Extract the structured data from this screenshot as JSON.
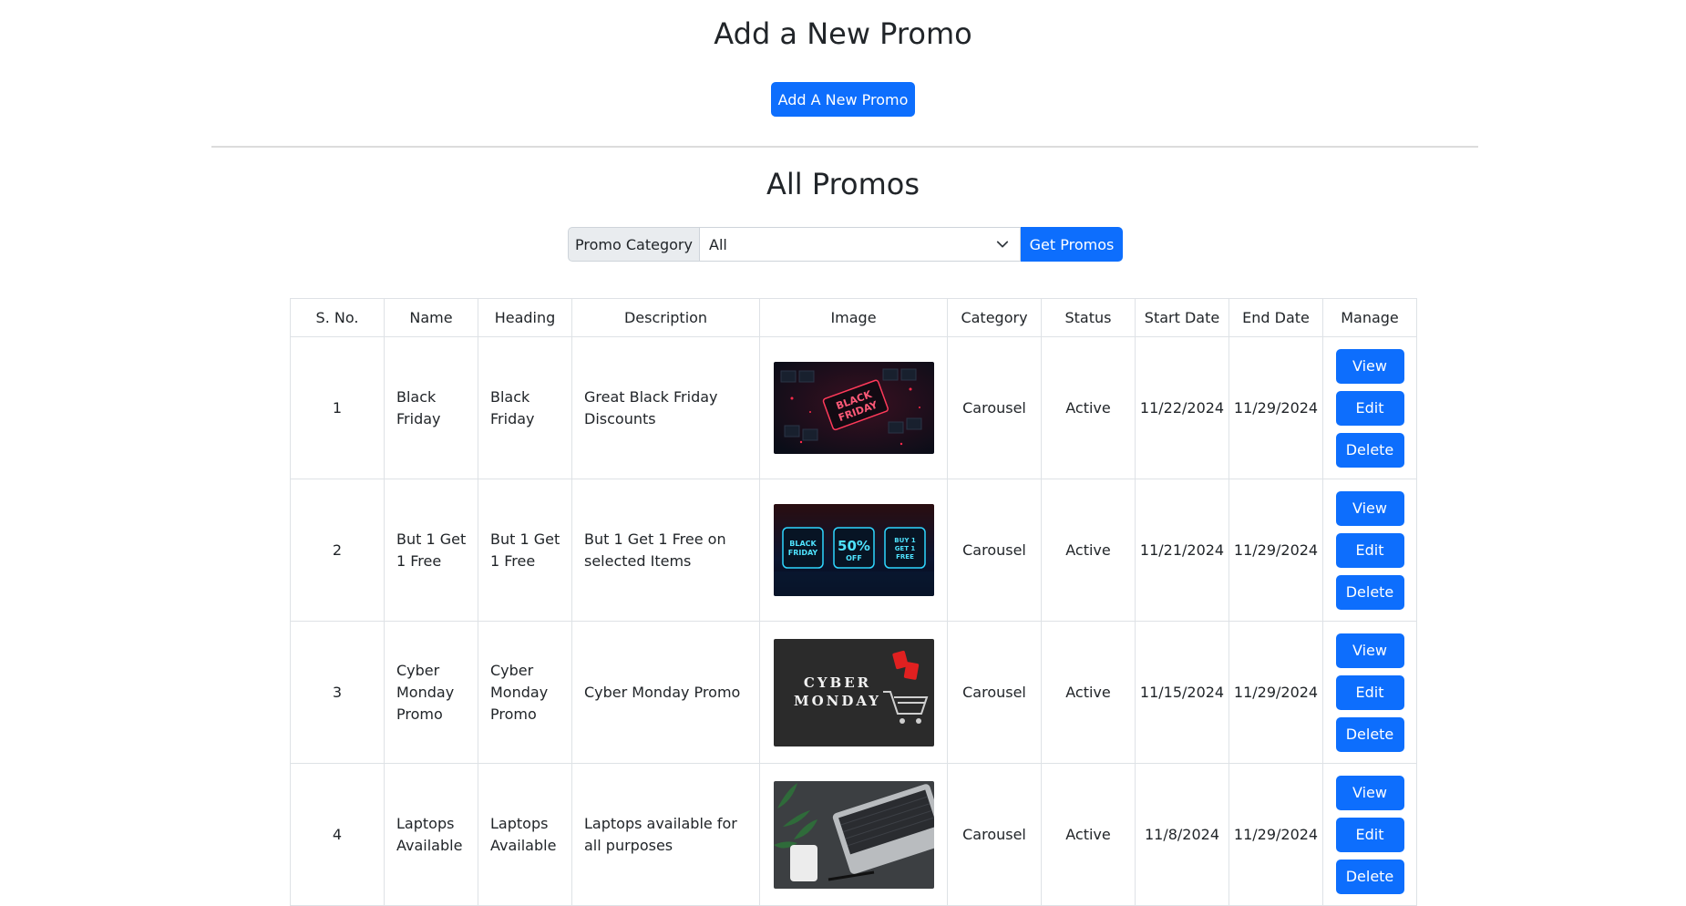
{
  "header": {
    "add_title": "Add a New Promo",
    "add_button": "Add A New Promo",
    "all_title": "All Promos"
  },
  "filter": {
    "label": "Promo Category",
    "selected": "All",
    "button": "Get Promos"
  },
  "table": {
    "columns": [
      "S. No.",
      "Name",
      "Heading",
      "Description",
      "Image",
      "Category",
      "Status",
      "Start Date",
      "End Date",
      "Manage"
    ],
    "actions": {
      "view": "View",
      "edit": "Edit",
      "delete": "Delete"
    },
    "rows": [
      {
        "sno": "1",
        "name": "Black Friday",
        "heading": "Black Friday",
        "description": "Great Black Friday Discounts",
        "image": {
          "alt": "black-friday-keyboard",
          "text": "BLACK FRIDAY"
        },
        "category": "Carousel",
        "status": "Active",
        "start": "11/22/2024",
        "end": "11/29/2024"
      },
      {
        "sno": "2",
        "name": "But 1 Get 1 Free",
        "heading": "But 1 Get 1 Free",
        "description": "But 1 Get 1 Free on selected Items",
        "image": {
          "alt": "neon-promo-boxes",
          "text": [
            "BLACK FRIDAY",
            "50% OFF",
            "BUY 1 GET 1 FREE"
          ]
        },
        "category": "Carousel",
        "status": "Active",
        "start": "11/21/2024",
        "end": "11/29/2024"
      },
      {
        "sno": "3",
        "name": "Cyber Monday Promo",
        "heading": "Cyber Monday Promo",
        "description": "Cyber Monday Promo",
        "image": {
          "alt": "cyber-monday-cart",
          "text": [
            "CYBER",
            "MONDAY"
          ]
        },
        "category": "Carousel",
        "status": "Active",
        "start": "11/15/2024",
        "end": "11/29/2024"
      },
      {
        "sno": "4",
        "name": "Laptops Available",
        "heading": "Laptops Available",
        "description": "Laptops available for all purposes",
        "image": {
          "alt": "laptop-desk"
        },
        "category": "Carousel",
        "status": "Active",
        "start": "11/8/2024",
        "end": "11/29/2024"
      }
    ]
  },
  "colors": {
    "primary": "#0d6efd",
    "border": "#dee2e6",
    "input_group_bg": "#e9ecef"
  }
}
